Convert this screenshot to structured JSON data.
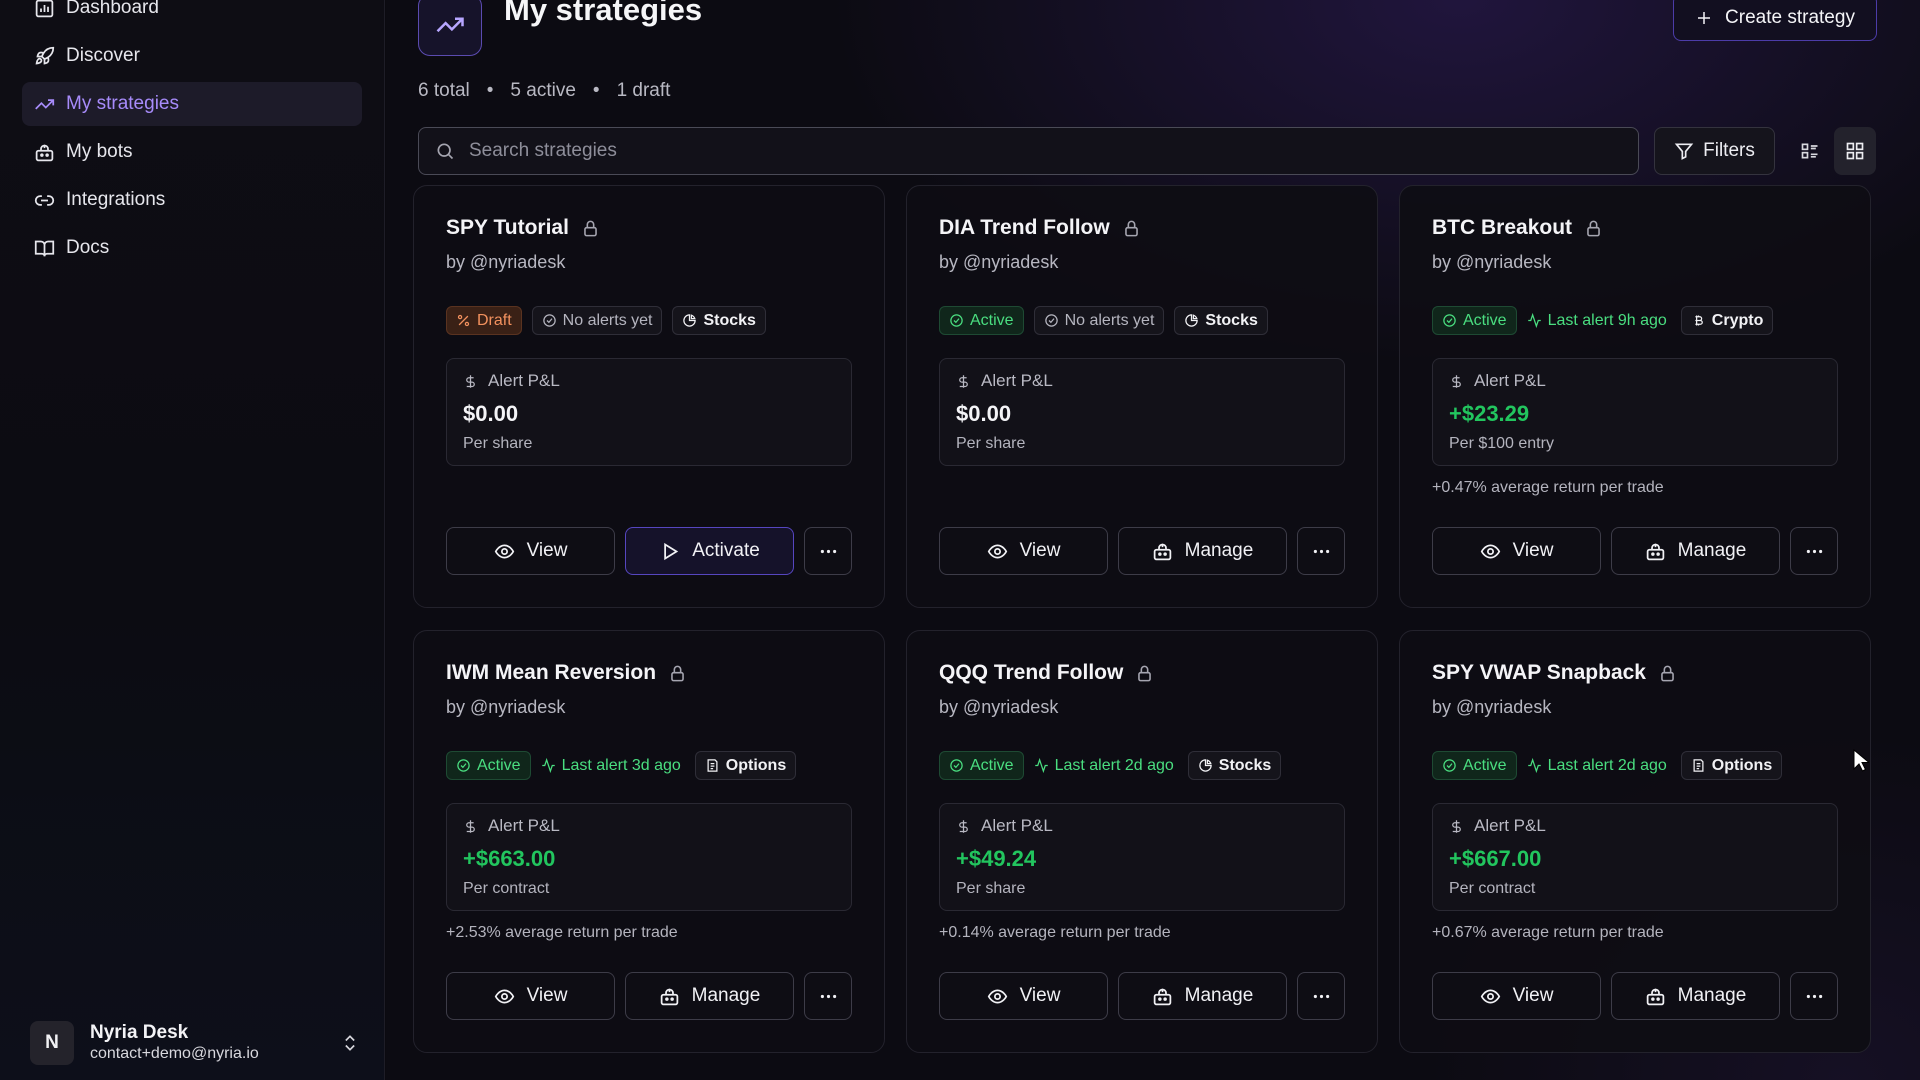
{
  "sidebar": {
    "items": [
      {
        "label": "Dashboard",
        "icon": "chart-icon",
        "active": false
      },
      {
        "label": "Discover",
        "icon": "rocket-icon",
        "active": false
      },
      {
        "label": "My strategies",
        "icon": "trend-icon",
        "active": true
      },
      {
        "label": "My bots",
        "icon": "bot-icon",
        "active": false
      },
      {
        "label": "Integrations",
        "icon": "link-icon",
        "active": false
      },
      {
        "label": "Docs",
        "icon": "book-icon",
        "active": false
      }
    ],
    "user": {
      "initial": "N",
      "name": "Nyria Desk",
      "email": "contact+demo@nyria.io"
    }
  },
  "header": {
    "title": "My strategies",
    "create_label": "Create strategy",
    "stats": {
      "total": "6 total",
      "active": "5 active",
      "draft": "1 draft",
      "separator": "•"
    }
  },
  "toolbar": {
    "search_placeholder": "Search strategies",
    "filters_label": "Filters"
  },
  "colors": {
    "accent": "#a78bfa",
    "positive": "#22c55e",
    "draft": "#f2915e",
    "active_badge": "#4ade80"
  },
  "cards": [
    {
      "title": "SPY Tutorial",
      "author": "by @nyriadesk",
      "status": "Draft",
      "status_kind": "draft",
      "alert": "No alerts yet",
      "alert_kind": "none",
      "category": "Stocks",
      "category_icon": "pie-icon",
      "pnl_label": "Alert P&L",
      "pnl_value": "$0.00",
      "pnl_positive": false,
      "pnl_unit": "Per share",
      "avg_return": "",
      "primary_label": "View",
      "secondary_label": "Activate",
      "secondary_kind": "activate"
    },
    {
      "title": "DIA Trend Follow",
      "author": "by @nyriadesk",
      "status": "Active",
      "status_kind": "active",
      "alert": "No alerts yet",
      "alert_kind": "none",
      "category": "Stocks",
      "category_icon": "pie-icon",
      "pnl_label": "Alert P&L",
      "pnl_value": "$0.00",
      "pnl_positive": false,
      "pnl_unit": "Per share",
      "avg_return": "",
      "primary_label": "View",
      "secondary_label": "Manage",
      "secondary_kind": "manage"
    },
    {
      "title": "BTC Breakout",
      "author": "by @nyriadesk",
      "status": "Active",
      "status_kind": "active",
      "alert": "Last alert 9h ago",
      "alert_kind": "alert",
      "category": "Crypto",
      "category_icon": "bitcoin-icon",
      "pnl_label": "Alert P&L",
      "pnl_value": "+$23.29",
      "pnl_positive": true,
      "pnl_unit": "Per $100 entry",
      "avg_return": "+0.47% average return per trade",
      "primary_label": "View",
      "secondary_label": "Manage",
      "secondary_kind": "manage"
    },
    {
      "title": "IWM Mean Reversion",
      "author": "by @nyriadesk",
      "status": "Active",
      "status_kind": "active",
      "alert": "Last alert 3d ago",
      "alert_kind": "alert",
      "category": "Options",
      "category_icon": "doc-icon",
      "pnl_label": "Alert P&L",
      "pnl_value": "+$663.00",
      "pnl_positive": true,
      "pnl_unit": "Per contract",
      "avg_return": "+2.53% average return per trade",
      "primary_label": "View",
      "secondary_label": "Manage",
      "secondary_kind": "manage"
    },
    {
      "title": "QQQ Trend Follow",
      "author": "by @nyriadesk",
      "status": "Active",
      "status_kind": "active",
      "alert": "Last alert 2d ago",
      "alert_kind": "alert",
      "category": "Stocks",
      "category_icon": "pie-icon",
      "pnl_label": "Alert P&L",
      "pnl_value": "+$49.24",
      "pnl_positive": true,
      "pnl_unit": "Per share",
      "avg_return": "+0.14% average return per trade",
      "primary_label": "View",
      "secondary_label": "Manage",
      "secondary_kind": "manage"
    },
    {
      "title": "SPY VWAP Snapback",
      "author": "by @nyriadesk",
      "status": "Active",
      "status_kind": "active",
      "alert": "Last alert 2d ago",
      "alert_kind": "alert",
      "category": "Options",
      "category_icon": "doc-icon",
      "pnl_label": "Alert P&L",
      "pnl_value": "+$667.00",
      "pnl_positive": true,
      "pnl_unit": "Per contract",
      "avg_return": "+0.67% average return per trade",
      "primary_label": "View",
      "secondary_label": "Manage",
      "secondary_kind": "manage"
    }
  ]
}
